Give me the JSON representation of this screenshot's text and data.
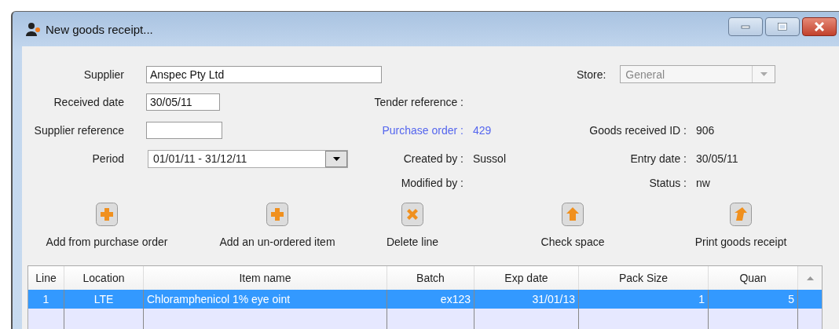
{
  "window": {
    "title": "New goods receipt..."
  },
  "form": {
    "supplier": {
      "label": "Supplier",
      "value": "Anspec Pty Ltd"
    },
    "received_date": {
      "label": "Received date",
      "value": "30/05/11"
    },
    "supplier_reference": {
      "label": "Supplier reference"
    },
    "period": {
      "label": "Period",
      "value": "01/01/11 - 31/12/11"
    },
    "store": {
      "label": "Store:",
      "value": "General",
      "disabled": true
    }
  },
  "info": {
    "tender_reference": {
      "label": "Tender reference :"
    },
    "purchase_order": {
      "label": "Purchase order :",
      "value": "429"
    },
    "created_by": {
      "label": "Created by :",
      "value": "Sussol"
    },
    "modified_by": {
      "label": "Modified by :"
    },
    "goods_received_id": {
      "label": "Goods received ID :",
      "value": "906"
    },
    "entry_date": {
      "label": "Entry date :",
      "value": "30/05/11"
    },
    "status": {
      "label": "Status :",
      "value": "nw"
    }
  },
  "toolbar": [
    {
      "label": "Add from purchase order",
      "kind": "add"
    },
    {
      "label": "Add an un-ordered item",
      "kind": "add"
    },
    {
      "label": "Delete line",
      "kind": "delete"
    },
    {
      "label": "Check space",
      "kind": "up"
    },
    {
      "label": "Print goods receipt",
      "kind": "print"
    }
  ],
  "table": {
    "columns": [
      "Line",
      "Location",
      "Item name",
      "Batch",
      "Exp date",
      "Pack Size",
      "Quan"
    ],
    "rows": [
      {
        "cells": [
          "1",
          "LTE",
          "Chloramphenicol 1% eye oint",
          "ex123",
          "31/01/13",
          "1",
          "5"
        ],
        "selected": true
      }
    ]
  }
}
